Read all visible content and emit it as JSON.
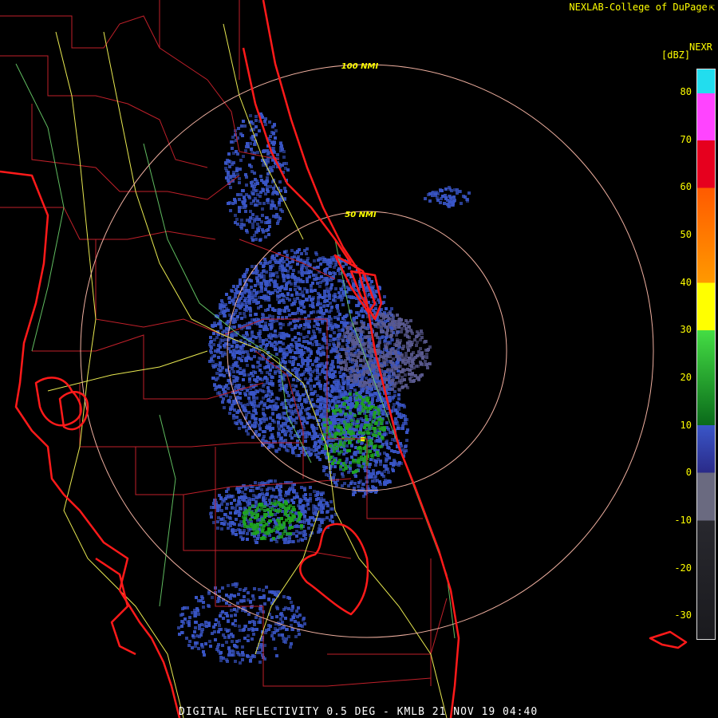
{
  "credit": "NEXLAB-College of DuPage",
  "credit_icon": "nexlab-logo-icon",
  "legend": {
    "product": "NEXR",
    "unit": "[dBZ]",
    "min": -35,
    "max": 85,
    "ticks": [
      80,
      70,
      60,
      50,
      40,
      30,
      20,
      10,
      0,
      -10,
      -20,
      -30
    ],
    "colors": {
      "below_-10": "#28282e",
      "-10_to_0": "#6a6a80",
      "0_to_10": "#3a56c8",
      "10_to_30": "#1fa41f",
      "30_to_40": "#ffff00",
      "40_to_60": "#ff5a00",
      "60_to_70": "#e6001e",
      "70_to_80": "#ff44ff",
      "above_80": "#22ddee"
    }
  },
  "range_rings": [
    {
      "label": "100 NMI"
    },
    {
      "label": "50 NMI"
    }
  ],
  "footer": "DIGITAL REFLECTIVITY 0.5 DEG - KMLB 21 NOV 19 04:40",
  "colors": {
    "background": "#000000",
    "coastline": "#ff1a1a",
    "county_lines": "#c0202a",
    "roads": "#e8e850",
    "rivers": "#6ad06a",
    "rings": "#f0b0a0"
  }
}
